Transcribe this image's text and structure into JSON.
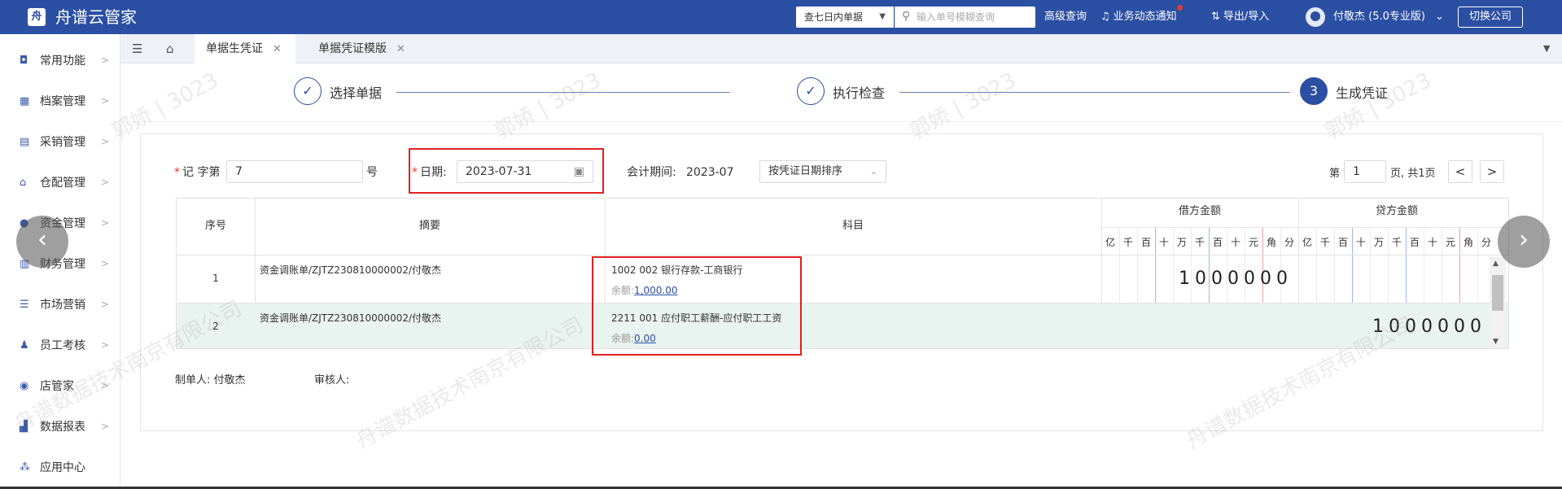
{
  "app": {
    "title": "舟谱云管家",
    "logo_glyph": "舟"
  },
  "topbar": {
    "range_select": "查七日内单据",
    "search_placeholder": "输入单号模糊查询",
    "advanced_search": "高级查询",
    "notifications": "业务动态通知",
    "import_export": "导出/导入",
    "user": "付敬杰 (5.0专业版)",
    "switch_company": "切换公司"
  },
  "sidebar": {
    "items": [
      {
        "label": "常用功能",
        "icon": "monitor-icon"
      },
      {
        "label": "档案管理",
        "icon": "grid-icon"
      },
      {
        "label": "采销管理",
        "icon": "clipboard-icon"
      },
      {
        "label": "仓配管理",
        "icon": "warehouse-icon"
      },
      {
        "label": "资金管理",
        "icon": "money-bag-icon"
      },
      {
        "label": "财务管理",
        "icon": "calculator-icon"
      },
      {
        "label": "市场营销",
        "icon": "shop-icon"
      },
      {
        "label": "员工考核",
        "icon": "people-icon"
      },
      {
        "label": "店管家",
        "icon": "store-icon"
      },
      {
        "label": "数据报表",
        "icon": "bar-chart-icon"
      },
      {
        "label": "应用中心",
        "icon": "apps-icon"
      }
    ]
  },
  "tabs": [
    {
      "label": "单据生凭证",
      "active": true
    },
    {
      "label": "单据凭证模版",
      "active": false
    }
  ],
  "steps": [
    {
      "label": "选择单据",
      "state": "done"
    },
    {
      "label": "执行检查",
      "state": "done"
    },
    {
      "label": "生成凭证",
      "state": "current",
      "number": "3"
    }
  ],
  "form": {
    "voucher_prefix": "记 字第",
    "voucher_no": "7",
    "voucher_suffix": "号",
    "date_label": "日期:",
    "date_value": "2023-07-31",
    "period_label": "会计期间:",
    "period_value": "2023-07",
    "sort_select": "按凭证日期排序",
    "page_prefix": "第",
    "page_value": "1",
    "page_suffix": "页, 共1页"
  },
  "table": {
    "headers": {
      "index": "序号",
      "summary": "摘要",
      "account": "科目",
      "debit": "借方金额",
      "credit": "贷方金额"
    },
    "digit_units": [
      "亿",
      "千",
      "百",
      "十",
      "万",
      "千",
      "百",
      "十",
      "元",
      "角",
      "分"
    ],
    "rows": [
      {
        "index": "1",
        "summary": "资金调账单/ZJTZ230810000002/付敬杰",
        "account": "1002 002 银行存款-工商银行",
        "balance_label": "余额:",
        "balance": "1,000.00",
        "debit": "1000000",
        "credit": ""
      },
      {
        "index": "2",
        "summary": "资金调账单/ZJTZ230810000002/付敬杰",
        "account": "2211 001 应付职工薪酬-应付职工工资",
        "balance_label": "余额:",
        "balance": "0.00",
        "debit": "",
        "credit": "1000000"
      }
    ]
  },
  "footer": {
    "maker": "制单人: 付敬杰",
    "reviewer": "审核人:"
  },
  "watermarks": [
    "郭娇 | 3023",
    "舟谱数据技术南京有限公司"
  ],
  "colors": {
    "brand": "#2b4fa3",
    "highlight": "#e02020",
    "required": "#e53935"
  }
}
